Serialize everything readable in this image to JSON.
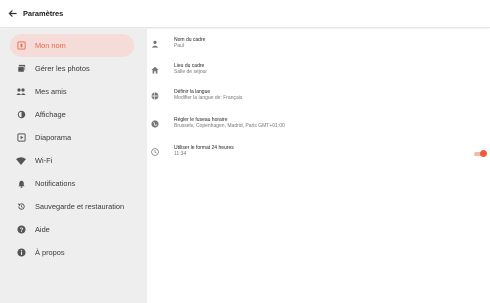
{
  "header": {
    "title": "Paramètres",
    "back_icon": "arrow-left-icon"
  },
  "sidebar": {
    "items": [
      {
        "label": "Mon nom",
        "icon": "name-badge-icon",
        "active": true
      },
      {
        "label": "Gérer les photos",
        "icon": "photos-icon",
        "active": false
      },
      {
        "label": "Mes amis",
        "icon": "people-icon",
        "active": false
      },
      {
        "label": "Affichage",
        "icon": "brightness-icon",
        "active": false
      },
      {
        "label": "Diaporama",
        "icon": "slideshow-icon",
        "active": false
      },
      {
        "label": "Wi-Fi",
        "icon": "wifi-icon",
        "active": false
      },
      {
        "label": "Notifications",
        "icon": "bell-icon",
        "active": false
      },
      {
        "label": "Sauvegarde et restauration",
        "icon": "backup-restore-icon",
        "active": false
      },
      {
        "label": "Aide",
        "icon": "help-icon",
        "active": false
      },
      {
        "label": "À propos",
        "icon": "info-icon",
        "active": false
      }
    ]
  },
  "settings": [
    {
      "title": "Nom du cadre",
      "value": "Paul",
      "icon": "person-icon"
    },
    {
      "title": "Lieu du cadre",
      "value": "Salle de séjour",
      "icon": "home-icon"
    },
    {
      "title": "Définir la langue",
      "value": "Modifier la langue de: Français",
      "icon": "globe-icon"
    },
    {
      "title": "Régler le fuseau horaire",
      "value": "Brussels, Copenhagen, Madrid, Paris GMT+01:00",
      "icon": "timezone-globe-icon"
    },
    {
      "title": "Utiliser le format 24 heures",
      "value": "11:34",
      "icon": "clock-icon",
      "toggle_on": true
    }
  ],
  "colors": {
    "accent": "#f05a3a",
    "active_bg": "#f6dcd9",
    "sidebar_bg": "#eeeeee"
  }
}
